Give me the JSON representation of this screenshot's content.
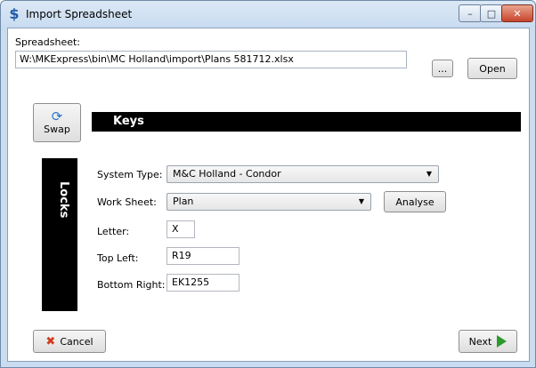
{
  "window": {
    "title": "Import Spreadsheet",
    "icon": "dollar-app-icon",
    "controls": {
      "minimize": "–",
      "maximize": "□",
      "close": "✕"
    }
  },
  "spreadsheet": {
    "label": "Spreadsheet:",
    "path": "W:\\MKExpress\\bin\\MC Holland\\import\\Plans 581712.xlsx",
    "browse_label": "...",
    "open_label": "Open"
  },
  "swap": {
    "label": "Swap",
    "icon": "swap-icon"
  },
  "keys": {
    "title": "Keys"
  },
  "locks": {
    "title": "Locks"
  },
  "form": {
    "system_type": {
      "label": "System Type:",
      "value": "M&C Holland - Condor"
    },
    "work_sheet": {
      "label": "Work Sheet:",
      "value": "Plan"
    },
    "analyse_label": "Analyse",
    "letter": {
      "label": "Letter:",
      "value": "X"
    },
    "top_left": {
      "label": "Top Left:",
      "value": "R19"
    },
    "bottom_right": {
      "label": "Bottom Right:",
      "value": "EK1255"
    }
  },
  "footer": {
    "cancel_label": "Cancel",
    "next_label": "Next"
  },
  "colors": {
    "accent_dark": "#000000",
    "cancel_icon": "#d2391a",
    "next_icon": "#2e9a2e"
  }
}
